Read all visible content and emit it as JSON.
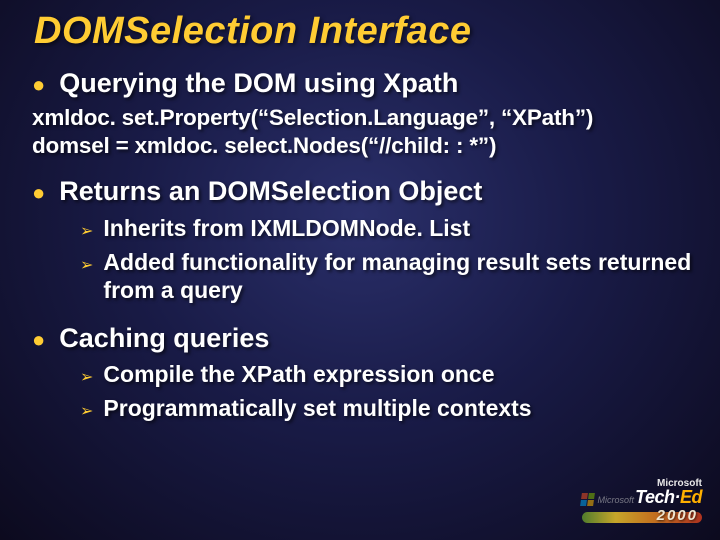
{
  "title": "DOMSelection Interface",
  "bullets": [
    {
      "level": 1,
      "text": "Querying the DOM using Xpath"
    }
  ],
  "code": {
    "line1": "xmldoc. set.Property(“Selection.Language”, “XPath”)",
    "line2": "domsel = xmldoc. select.Nodes(“//child: : *”)"
  },
  "bullet_returns": "Returns an DOMSelection Object",
  "returns_sub": [
    "Inherits from IXMLDOMNode. List",
    "Added functionality for managing result sets returned from a query"
  ],
  "bullet_caching": "Caching queries",
  "caching_sub": [
    "Compile the XPath expression once",
    "Programmatically set multiple contexts"
  ],
  "footer": {
    "microsoft": "Microsoft",
    "tech": "Tech·",
    "ed": "Ed",
    "year": "2000"
  }
}
